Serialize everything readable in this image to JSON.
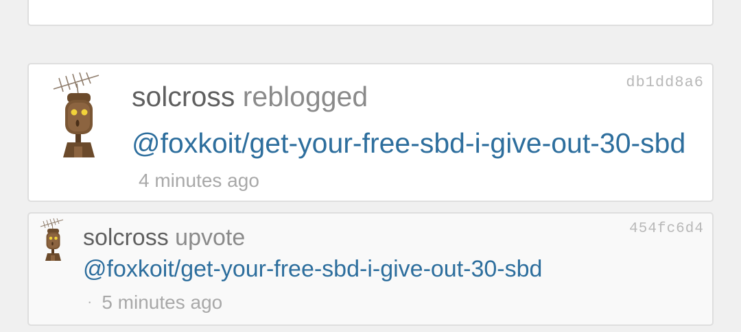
{
  "feed": {
    "items": [
      {
        "hash": "db1dd8a6",
        "user": "solcross",
        "action": "reblogged",
        "link": "@foxkoit/get-your-free-sbd-i-give-out-30-sbd",
        "time": "4 minutes ago",
        "avatar_icon": "robot-avatar-icon"
      },
      {
        "hash": "454fc6d4",
        "user": "solcross",
        "action": "upvote",
        "link": "@foxkoit/get-your-free-sbd-i-give-out-30-sbd",
        "dot": "·",
        "time": "5 minutes ago",
        "avatar_icon": "robot-avatar-icon"
      }
    ]
  },
  "colors": {
    "background": "#f0f0f0",
    "link": "#2d6e9d",
    "hash": "#b8b8b8",
    "muted": "#a8a8a8"
  }
}
